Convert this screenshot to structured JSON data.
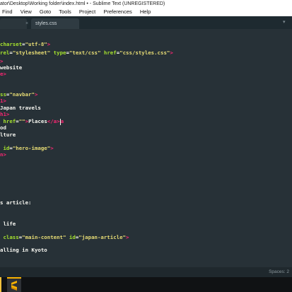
{
  "window": {
    "title": "ator\\Desktop\\Working folder\\index.html • - Sublime Text (UNREGISTERED)"
  },
  "menu": [
    "Find",
    "View",
    "Goto",
    "Tools",
    "Project",
    "Preferences",
    "Help"
  ],
  "tabs": [
    {
      "label": "",
      "active": true
    },
    {
      "label": "styles.css",
      "active": false
    }
  ],
  "code_lines": [
    "charset=\"utf-8\">",
    "rel=\"stylesheet\" type=\"text/css\" href=\"css/styles.css\">",
    ">",
    "website",
    "e>",
    "",
    "",
    "ss=\"navbar\">",
    "1>",
    "Japan travels",
    "h1>",
    " href=\"\">Places</a>",
    "od",
    "lture",
    "",
    " id=\"hero-image\">",
    "n>",
    "",
    "",
    "",
    "",
    "",
    "s article:",
    "",
    "",
    " life",
    "",
    " class=\"main-content\" id=\"japan-article\">",
    "",
    "alling in Kyoto"
  ],
  "status": {
    "spaces": "Spaces: 2"
  },
  "colors": {
    "background": "#273137",
    "tag": "#f92672",
    "attribute": "#a6e22e",
    "string": "#e6db74",
    "text": "#f8f8f2"
  },
  "icons": {
    "tab_close": "close-icon",
    "tab_dropdown": "chevron-down-icon",
    "taskbar_app": "sublime-text-icon"
  }
}
